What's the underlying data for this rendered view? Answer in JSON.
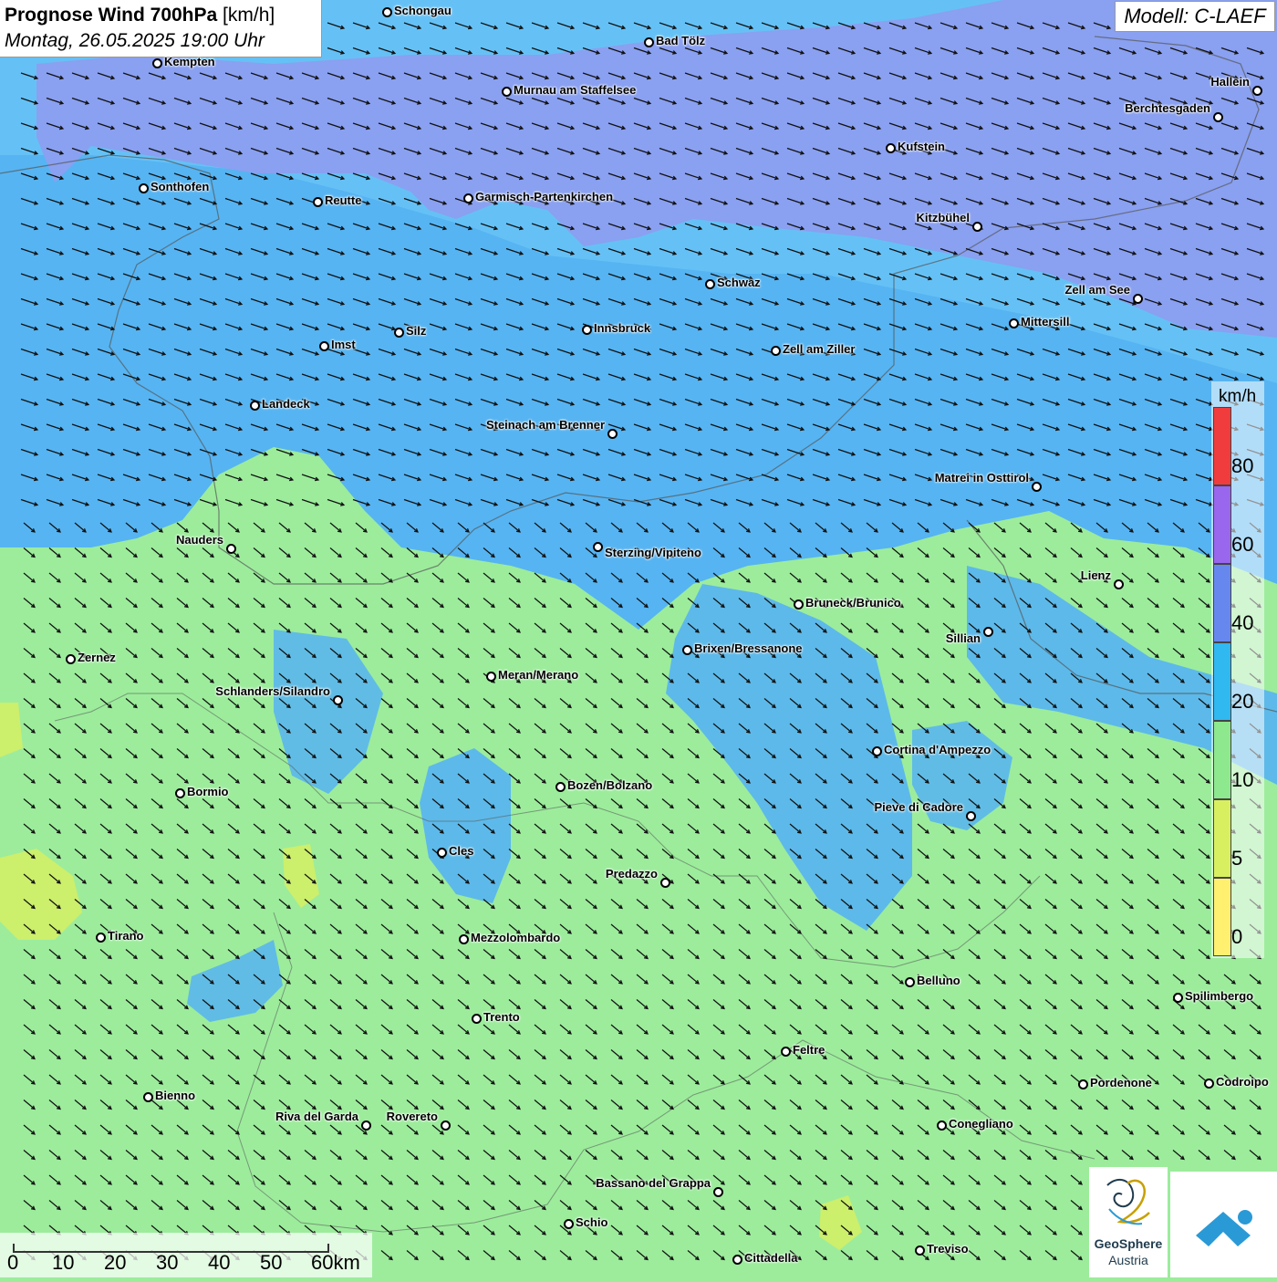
{
  "header": {
    "title_bold": "Prognose Wind 700hPa",
    "title_unit": " [km/h]",
    "subtitle": "Montag, 26.05.2025 19:00 Uhr"
  },
  "model_label": "Modell: C-LAEF",
  "legend": {
    "unit": "km/h",
    "ticks": [
      "80",
      "60",
      "40",
      "20",
      "10",
      "5",
      "0"
    ],
    "colors": [
      "#f03c3c",
      "#9966ee",
      "#6688ee",
      "#30b8f0",
      "#8ee88e",
      "#d8f060",
      "#fff070"
    ]
  },
  "scalebar": {
    "labels": [
      "0",
      "10",
      "20",
      "30",
      "40",
      "50",
      "60km"
    ]
  },
  "logos": {
    "geosphere_line1": "GeoSphere",
    "geosphere_line2": "Austria"
  },
  "map_colors": {
    "over60": "#8aa0f0",
    "c40_60": "#6cc6f6",
    "c20_40": "#56b4f2",
    "c10_20": "#9cec9c",
    "c5_10": "#d8f060",
    "arrow": "#111111"
  },
  "cities": [
    {
      "name": "Schongau"
    },
    {
      "name": "Bad Tölz"
    },
    {
      "name": "Kempten"
    },
    {
      "name": "Murnau am Staffelsee"
    },
    {
      "name": "Hallein"
    },
    {
      "name": "Berchtesgaden"
    },
    {
      "name": "Kufstein"
    },
    {
      "name": "Sonthofen"
    },
    {
      "name": "Reutte"
    },
    {
      "name": "Garmisch-Partenkirchen"
    },
    {
      "name": "Kitzbühel"
    },
    {
      "name": "Schwaz"
    },
    {
      "name": "Zell am See"
    },
    {
      "name": "Mittersill"
    },
    {
      "name": "Innsbruck"
    },
    {
      "name": "Silz"
    },
    {
      "name": "Imst"
    },
    {
      "name": "Zell am Ziller"
    },
    {
      "name": "Landeck"
    },
    {
      "name": "Steinach am Brenner"
    },
    {
      "name": "Matrei in Osttirol"
    },
    {
      "name": "Nauders"
    },
    {
      "name": "Sterzing/Vipiteno"
    },
    {
      "name": "Lienz"
    },
    {
      "name": "Bruneck/Brunico"
    },
    {
      "name": "Sillian"
    },
    {
      "name": "Zernez"
    },
    {
      "name": "Brixen/Bressanone"
    },
    {
      "name": "Meran/Merano"
    },
    {
      "name": "Schlanders/Silandro"
    },
    {
      "name": "Cortina d'Ampezzo"
    },
    {
      "name": "Bozen/Bolzano"
    },
    {
      "name": "Bormio"
    },
    {
      "name": "Pieve di Cadore"
    },
    {
      "name": "Cles"
    },
    {
      "name": "Predazzo"
    },
    {
      "name": "Tirano"
    },
    {
      "name": "Mezzolombardo"
    },
    {
      "name": "Belluno"
    },
    {
      "name": "Spilimbergo"
    },
    {
      "name": "Trento"
    },
    {
      "name": "Feltre"
    },
    {
      "name": "Pordenone"
    },
    {
      "name": "Codroipo"
    },
    {
      "name": "Bienno"
    },
    {
      "name": "Riva del Garda"
    },
    {
      "name": "Rovereto"
    },
    {
      "name": "Conegliano"
    },
    {
      "name": "Bassano del Grappa"
    },
    {
      "name": "Schio"
    },
    {
      "name": "Treviso"
    },
    {
      "name": "Cittadella"
    }
  ]
}
